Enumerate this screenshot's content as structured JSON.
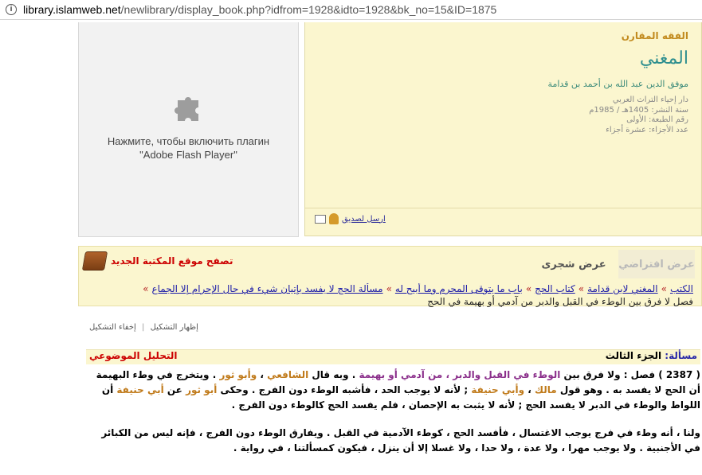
{
  "browser": {
    "url_host": "library.islamweb.net",
    "url_path": "/newlibrary/display_book.php?idfrom=1928&idto=1928&bk_no=15&ID=1875"
  },
  "flash": {
    "message_line1": "Нажмите, чтобы включить плагин",
    "message_line2": "\"Adobe Flash Player\""
  },
  "book": {
    "category": "الفقه المقارن",
    "title": "المغني",
    "author": "موفق الدين عبد الله بن أحمد بن قدامة",
    "publisher": "دار إحياء التراث العربي",
    "pub_year": "سنة النشر: 1405هـ / 1985م",
    "edition": "رقم الطبعة: الأولى",
    "parts": "عدد الأجزاء: عشرة أجزاء",
    "send_label": "ارسل لصديق"
  },
  "tabs": {
    "default_view": "عرض افتراضي",
    "tree_view": "عرض شجرى",
    "new_site": "تصفح موقع المكتبة الجديد"
  },
  "breadcrumb": {
    "items": [
      "الكتب",
      "المغني لابن قدامة",
      "كتاب الحج",
      "باب ما يتوقى المحرم وما أبيح له",
      "مسألة الحج لا يفسد بإتيان شيء في حال الإحرام إلا الجماع"
    ],
    "current": "فصل لا فرق بين الوطء في القبل والدبر من آدمي أو بهيمة في الحج"
  },
  "toggles": {
    "show": "إظهار التشكيل",
    "hide": "إخفاء التشكيل",
    "divider": "|"
  },
  "issue": {
    "label": "مسألة:",
    "value": "الجزء الثالث",
    "topical": "التحليل الموضوعي"
  },
  "content": {
    "p1_a": "( 2387 ) فصل : ولا فرق بين ",
    "p1_b": "الوطء في القبل والدبر ، من آدمي أو بهيمة",
    "p1_c": " . وبه قال ",
    "p1_d": "الشافعي",
    "p1_e": " ، ",
    "p1_f": "وأبو ثور",
    "p1_g": " . ويتخرج في وطء البهيمة أن الحج لا يفسد به . وهو قول ",
    "p1_h": "مالك",
    "p1_i": " ، ",
    "p1_j": "وأبي حنيفة",
    "p1_k": " ; لأنه لا يوجب الحد ، فأشبه الوطء دون الفرج . وحكى ",
    "p1_l": "أبو ثور",
    "p1_m": " عن ",
    "p1_n": "أبي حنيفة",
    "p1_o": " أن اللواط والوطء في الدبر لا يفسد الحج ; لأنه لا يثبت به الإحصان ، فلم يفسد الحج كالوطء دون الفرج .",
    "p2": "ولنا ، أنه وطء في فرج يوجب الاغتسال ، فأفسد الحج ، كوطء الآدمية في القبل . ويفارق الوطء دون الفرج ، فإنه ليس من الكبائر في الأجنبية . ولا يوجب مهرا ، ولا عدة ، ولا حدا ، ولا غسلا إلا أن ينزل ، فيكون كمسألتنا ، في رواية ."
  },
  "colors": {
    "accent_yellow": "#fbf6cf",
    "link_blue": "#1a1aa8",
    "highlight_red": "#cc0000",
    "name_orange": "#c07a1a",
    "phrase_purple": "#8b2f8b"
  }
}
